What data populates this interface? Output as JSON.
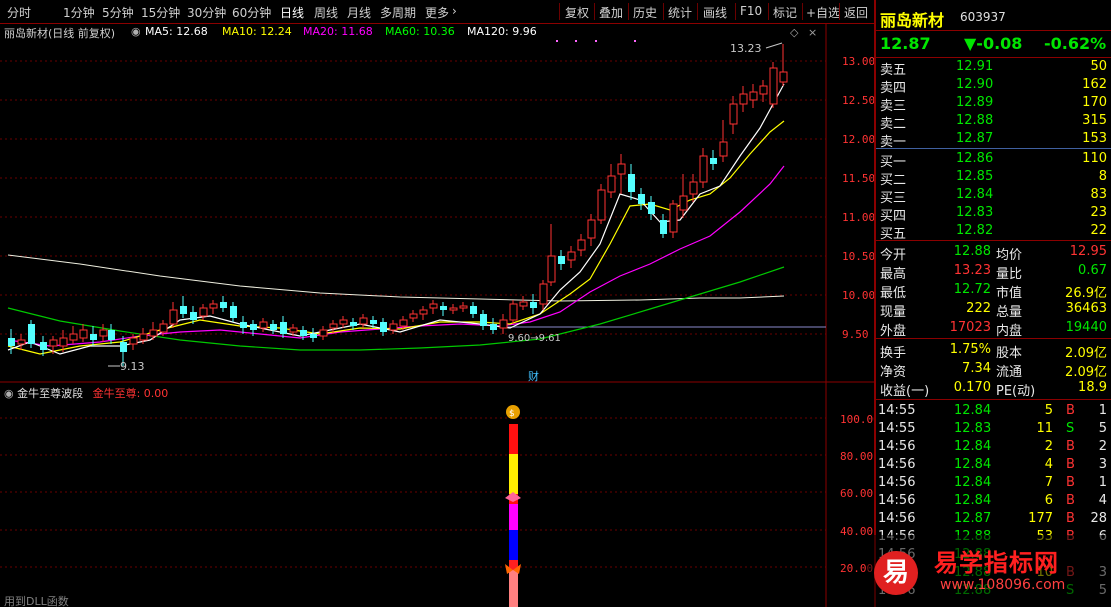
{
  "toolbar": {
    "left_tabs": [
      "分时",
      "1分钟",
      "5分钟",
      "15分钟",
      "30分钟",
      "60分钟",
      "日线",
      "周线",
      "月线",
      "多周期",
      "更多"
    ],
    "more_arrow": "›",
    "right_buttons": [
      "复权",
      "叠加",
      "历史",
      "统计",
      "画线",
      "F10",
      "标记",
      "+自选",
      "返回"
    ],
    "active_tab": "日线"
  },
  "chart_header": {
    "stock": "丽岛新材(日线 前复权)",
    "ma5": "MA5: 12.68",
    "ma10": "MA10: 12.24",
    "ma20": "MA20: 11.68",
    "ma60": "MA60: 10.36",
    "ma120": "MA120: 9.96",
    "colors": {
      "ma5": "#ffffff",
      "ma10": "#ffff00",
      "ma20": "#ff00ff",
      "ma60": "#00ff00",
      "ma120": "#ffffff"
    }
  },
  "price_axis": [
    "13.00",
    "12.50",
    "12.00",
    "11.50",
    "11.00",
    "10.50",
    "10.00",
    "9.50"
  ],
  "annotations": {
    "high": "13.23",
    "low": "9.13",
    "range": "9.60→9.61",
    "marker": "财"
  },
  "indicator": {
    "name": "金牛至尊波段",
    "param_label": "金牛至尊: 0.00",
    "axis": [
      "100.00",
      "80.00",
      "60.00",
      "40.00",
      "20.00"
    ],
    "status": "用到DLL函数"
  },
  "panel": {
    "name": "丽岛新材",
    "code": "603937",
    "price": "12.87",
    "change": "▼-0.08",
    "pct": "-0.62%",
    "asks": [
      {
        "label": "卖五",
        "price": "12.91",
        "vol": "50"
      },
      {
        "label": "卖四",
        "price": "12.90",
        "vol": "162"
      },
      {
        "label": "卖三",
        "price": "12.89",
        "vol": "170"
      },
      {
        "label": "卖二",
        "price": "12.88",
        "vol": "315"
      },
      {
        "label": "卖一",
        "price": "12.87",
        "vol": "153"
      }
    ],
    "bids": [
      {
        "label": "买一",
        "price": "12.86",
        "vol": "110"
      },
      {
        "label": "买二",
        "price": "12.85",
        "vol": "8"
      },
      {
        "label": "买三",
        "price": "12.84",
        "vol": "83"
      },
      {
        "label": "买四",
        "price": "12.83",
        "vol": "23"
      },
      {
        "label": "买五",
        "price": "12.82",
        "vol": "22"
      }
    ],
    "stats": [
      {
        "l1": "今开",
        "v1": "12.88",
        "l2": "均价",
        "v2": "12.95"
      },
      {
        "l1": "最高",
        "v1": "13.23",
        "l2": "量比",
        "v2": "0.67"
      },
      {
        "l1": "最低",
        "v1": "12.72",
        "l2": "市值",
        "v2": "26.9亿"
      },
      {
        "l1": "现量",
        "v1": "222",
        "l2": "总量",
        "v2": "36463"
      },
      {
        "l1": "外盘",
        "v1": "17023",
        "l2": "内盘",
        "v2": "19440"
      }
    ],
    "stats2": [
      {
        "l1": "换手",
        "v1": "1.75%",
        "l2": "股本",
        "v2": "2.09亿"
      },
      {
        "l1": "净资",
        "v1": "7.34",
        "l2": "流通",
        "v2": "2.09亿"
      },
      {
        "l1": "收益(一)",
        "v1": "0.170",
        "l2": "PE(动)",
        "v2": "18.9"
      }
    ],
    "ticks": [
      {
        "t": "14:55",
        "p": "12.84",
        "v": "5",
        "s": "B",
        "n": "1"
      },
      {
        "t": "14:55",
        "p": "12.83",
        "v": "11",
        "s": "S",
        "n": "5"
      },
      {
        "t": "14:56",
        "p": "12.84",
        "v": "2",
        "s": "B",
        "n": "2"
      },
      {
        "t": "14:56",
        "p": "12.84",
        "v": "4",
        "s": "B",
        "n": "3"
      },
      {
        "t": "14:56",
        "p": "12.84",
        "v": "7",
        "s": "B",
        "n": "1"
      },
      {
        "t": "14:56",
        "p": "12.84",
        "v": "6",
        "s": "B",
        "n": "4"
      },
      {
        "t": "14:56",
        "p": "12.87",
        "v": "177",
        "s": "B",
        "n": "28"
      },
      {
        "t": "14:56",
        "p": "12.88",
        "v": "53",
        "s": "B",
        "n": "6"
      },
      {
        "t": "14:56",
        "p": "12.88",
        "v": "",
        "s": "",
        "n": ""
      },
      {
        "t": "14:56",
        "p": "12.88",
        "v": "10",
        "s": "B",
        "n": "3"
      },
      {
        "t": "14:56",
        "p": "12.88",
        "v": "",
        "s": "S",
        "n": "5"
      }
    ]
  },
  "watermark": {
    "logo_char": "易",
    "title": "易学指标网",
    "url": "www.108096.com"
  }
}
